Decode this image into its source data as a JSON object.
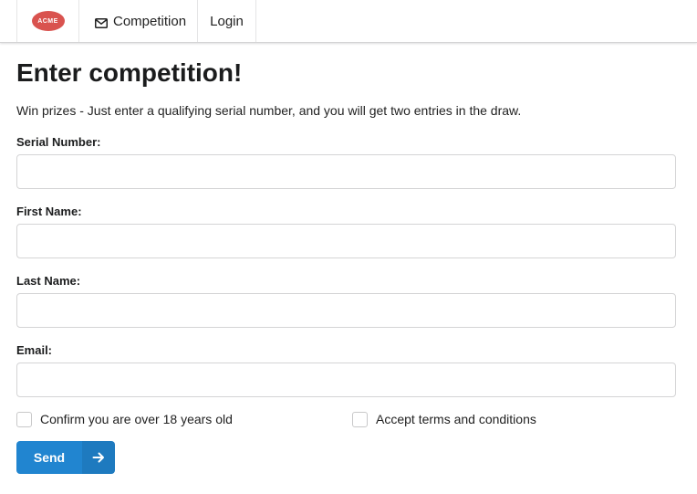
{
  "nav": {
    "logo_text": "ACME",
    "logo_color": "#d9534f",
    "competition_icon": "envelope-icon",
    "competition_label": "Competition",
    "login_label": "Login"
  },
  "main": {
    "title": "Enter competition!",
    "intro": "Win prizes - Just enter a qualifying serial number, and you will get two entries in the draw."
  },
  "form": {
    "fields": [
      {
        "label": "Serial Number:",
        "value": ""
      },
      {
        "label": "First Name:",
        "value": ""
      },
      {
        "label": "Last Name:",
        "value": ""
      },
      {
        "label": "Email:",
        "value": ""
      }
    ],
    "checkboxes": [
      {
        "label": "Confirm you are over 18 years old",
        "checked": false
      },
      {
        "label": "Accept terms and conditions",
        "checked": false
      }
    ],
    "submit_label": "Send",
    "submit_icon": "arrow-right-icon",
    "accent_color": "#2185d0"
  }
}
